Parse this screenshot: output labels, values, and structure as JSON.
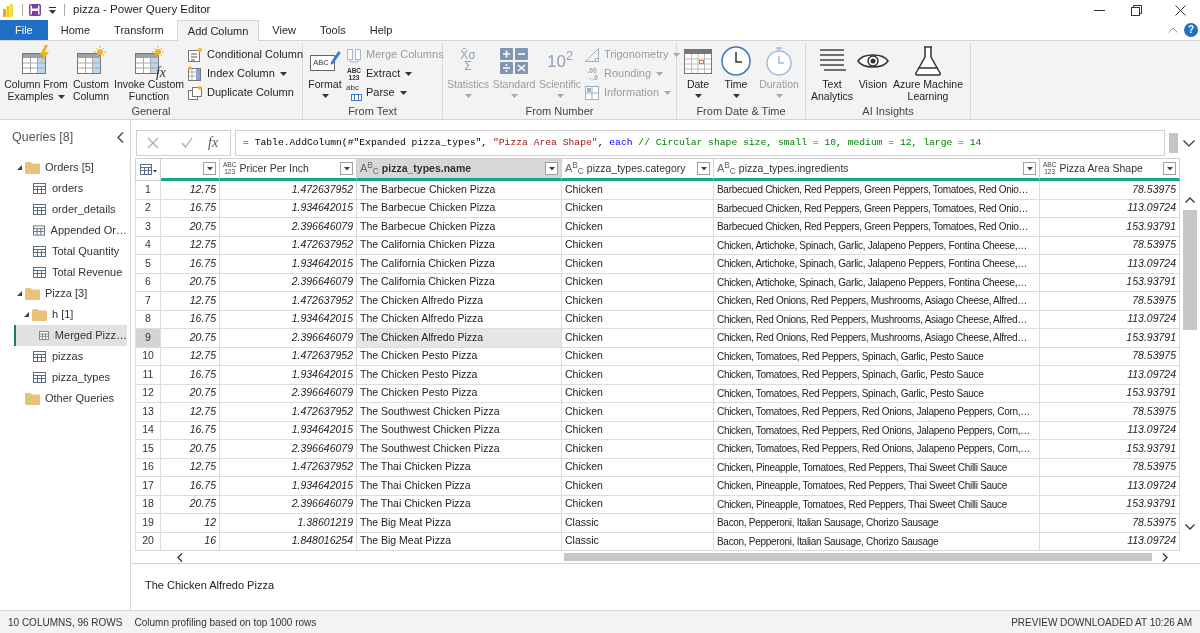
{
  "window": {
    "title": "pizza - Power Query Editor"
  },
  "tabs": [
    {
      "label": "File",
      "kind": "file",
      "selected": false
    },
    {
      "label": "Home",
      "kind": "tab",
      "selected": false
    },
    {
      "label": "Transform",
      "kind": "tab",
      "selected": false
    },
    {
      "label": "Add Column",
      "kind": "tab",
      "selected": true
    },
    {
      "label": "View",
      "kind": "tab",
      "selected": false
    },
    {
      "label": "Tools",
      "kind": "tab",
      "selected": false
    },
    {
      "label": "Help",
      "kind": "tab",
      "selected": false
    }
  ],
  "help": {
    "label": "?"
  },
  "ribbon": {
    "groups": [
      {
        "label": "General",
        "buttons": [
          {
            "kind": "large",
            "label": "Column From Examples",
            "dropdown": true,
            "disabled": false
          },
          {
            "kind": "large",
            "label": "Custom Column",
            "dropdown": false,
            "disabled": false
          },
          {
            "kind": "large",
            "label": "Invoke Custom Function",
            "dropdown": false,
            "disabled": false,
            "glyph": [
              "fx"
            ]
          },
          {
            "kind": "small",
            "label": "Conditional Column",
            "dropdown": false,
            "disabled": false
          },
          {
            "kind": "small",
            "label": "Index Column",
            "dropdown": true,
            "disabled": false
          },
          {
            "kind": "small",
            "label": "Duplicate Column",
            "dropdown": false,
            "disabled": false
          }
        ]
      },
      {
        "label": "From Text",
        "buttons": [
          {
            "kind": "large",
            "label": "Format",
            "dropdown": true,
            "disabled": false,
            "glyph": [
              "ABC"
            ]
          },
          {
            "kind": "small",
            "label": "Merge Columns",
            "dropdown": false,
            "disabled": true
          },
          {
            "kind": "small",
            "label": "Extract",
            "dropdown": true,
            "disabled": false,
            "glyph": [
              "ABC",
              "123"
            ]
          },
          {
            "kind": "small",
            "label": "Parse",
            "dropdown": true,
            "disabled": false,
            "glyph": [
              "abc"
            ]
          }
        ]
      },
      {
        "label": "From Number",
        "buttons": [
          {
            "kind": "large",
            "label": "Statistics",
            "dropdown": true,
            "disabled": true,
            "glyph": [
              "X̄σ",
              "Σ"
            ]
          },
          {
            "kind": "large",
            "label": "Standard",
            "dropdown": true,
            "disabled": true
          },
          {
            "kind": "large",
            "label": "Scientific",
            "dropdown": true,
            "disabled": true,
            "glyph": [
              "10$^{2}$"
            ]
          },
          {
            "kind": "small",
            "label": "Trigonometry",
            "dropdown": true,
            "disabled": true
          },
          {
            "kind": "small",
            "label": "Rounding",
            "dropdown": true,
            "disabled": true,
            "glyph": [
              ".00",
              "→.0"
            ]
          },
          {
            "kind": "small",
            "label": "Information",
            "dropdown": true,
            "disabled": true
          }
        ]
      },
      {
        "label": "From Date & Time",
        "buttons": [
          {
            "kind": "large",
            "label": "Date",
            "dropdown": true,
            "disabled": false
          },
          {
            "kind": "large",
            "label": "Time",
            "dropdown": true,
            "disabled": false
          },
          {
            "kind": "large",
            "label": "Duration",
            "dropdown": true,
            "disabled": true
          }
        ]
      },
      {
        "label": "AI Insights",
        "buttons": [
          {
            "kind": "large",
            "label": "Text Analytics",
            "dropdown": false,
            "disabled": false
          },
          {
            "kind": "large",
            "label": "Vision",
            "dropdown": false,
            "disabled": false
          },
          {
            "kind": "large",
            "label": "Azure Machine Learning",
            "dropdown": false,
            "disabled": false
          }
        ]
      }
    ]
  },
  "queries": {
    "title": "Queries [8]",
    "tree": [
      {
        "label": "Orders [5]",
        "kind": "folder",
        "expanded": true,
        "selected": false,
        "children": [
          {
            "label": "orders",
            "kind": "query",
            "selected": false
          },
          {
            "label": "order_details",
            "kind": "query",
            "selected": false
          },
          {
            "label": "Appended Or…",
            "kind": "query",
            "selected": false
          },
          {
            "label": "Total Quantity",
            "kind": "query",
            "selected": false
          },
          {
            "label": "Total Revenue",
            "kind": "query",
            "selected": false
          }
        ]
      },
      {
        "label": "Pizza [3]",
        "kind": "folder",
        "expanded": true,
        "selected": false,
        "children": [
          {
            "label": "h [1]",
            "kind": "folder",
            "expanded": true,
            "selected": false,
            "children": [
              {
                "label": "Merged Pizz…",
                "kind": "query",
                "selected": true
              }
            ]
          },
          {
            "label": "pizzas",
            "kind": "query",
            "selected": false
          },
          {
            "label": "pizza_types",
            "kind": "query",
            "selected": false
          }
        ]
      },
      {
        "label": "Other Queries",
        "kind": "folder",
        "selected": false
      }
    ]
  },
  "formula_bar": {
    "fx_label": "fx",
    "segments": [
      {
        "kind": "plain",
        "text": "= Table.AddColumn(#\"Expanded pizza_types\", "
      },
      {
        "kind": "string",
        "text": "\"Pizza Area Shape\""
      },
      {
        "kind": "plain",
        "text": ", "
      },
      {
        "kind": "keyword",
        "text": "each"
      },
      {
        "kind": "comment",
        "text": " // Circular shape size, small = 10, medium = 12, large = 14"
      }
    ]
  },
  "table": {
    "columns": [
      {
        "kind": "number",
        "selected": false
      },
      {
        "kind": "number",
        "label": "Pricer Per Inch",
        "type_glyph": [
          "ABC",
          "123"
        ],
        "selected": false
      },
      {
        "kind": "text",
        "label": "pizza_types.name",
        "type_glyph": [
          "A$^{B}$$_{C}$"
        ],
        "selected": true
      },
      {
        "kind": "text",
        "label": "pizza_types.category",
        "type_glyph": [
          "A$^{B}$$_{C}$"
        ],
        "selected": false
      },
      {
        "kind": "text",
        "label": "pizza_types.ingredients",
        "type_glyph": [
          "A$^{B}$$_{C}$"
        ],
        "selected": false
      },
      {
        "kind": "number",
        "label": "Pizza Area Shape",
        "type_glyph": [
          "ABC",
          "123"
        ],
        "selected": false
      }
    ],
    "rows": [
      {
        "number": "1",
        "selected": false,
        "cells": [
          "12.75",
          "1.472637952",
          "The Barbecue Chicken Pizza",
          "Chicken",
          "Barbecued Chicken, Red Peppers, Green Peppers, Tomatoes, Red Onio…",
          "78.53975"
        ]
      },
      {
        "number": "2",
        "selected": false,
        "cells": [
          "16.75",
          "1.934642015",
          "The Barbecue Chicken Pizza",
          "Chicken",
          "Barbecued Chicken, Red Peppers, Green Peppers, Tomatoes, Red Onio…",
          "113.09724"
        ]
      },
      {
        "number": "3",
        "selected": false,
        "cells": [
          "20.75",
          "2.396646079",
          "The Barbecue Chicken Pizza",
          "Chicken",
          "Barbecued Chicken, Red Peppers, Green Peppers, Tomatoes, Red Onio…",
          "153.93791"
        ]
      },
      {
        "number": "4",
        "selected": false,
        "cells": [
          "12.75",
          "1.472637952",
          "The California Chicken Pizza",
          "Chicken",
          "Chicken, Artichoke, Spinach, Garlic, Jalapeno Peppers, Fontina Cheese,…",
          "78.53975"
        ]
      },
      {
        "number": "5",
        "selected": false,
        "cells": [
          "16.75",
          "1.934642015",
          "The California Chicken Pizza",
          "Chicken",
          "Chicken, Artichoke, Spinach, Garlic, Jalapeno Peppers, Fontina Cheese,…",
          "113.09724"
        ]
      },
      {
        "number": "6",
        "selected": false,
        "cells": [
          "20.75",
          "2.396646079",
          "The California Chicken Pizza",
          "Chicken",
          "Chicken, Artichoke, Spinach, Garlic, Jalapeno Peppers, Fontina Cheese,…",
          "153.93791"
        ]
      },
      {
        "number": "7",
        "selected": false,
        "cells": [
          "12.75",
          "1.472637952",
          "The Chicken Alfredo Pizza",
          "Chicken",
          "Chicken, Red Onions, Red Peppers, Mushrooms, Asiago Cheese, Alfred…",
          "78.53975"
        ]
      },
      {
        "number": "8",
        "selected": false,
        "cells": [
          "16.75",
          "1.934642015",
          "The Chicken Alfredo Pizza",
          "Chicken",
          "Chicken, Red Onions, Red Peppers, Mushrooms, Asiago Cheese, Alfred…",
          "113.09724"
        ]
      },
      {
        "number": "9",
        "selected": true,
        "cells": [
          "20.75",
          "2.396646079",
          "The Chicken Alfredo Pizza",
          "Chicken",
          "Chicken, Red Onions, Red Peppers, Mushrooms, Asiago Cheese, Alfred…",
          "153.93791"
        ]
      },
      {
        "number": "10",
        "selected": false,
        "cells": [
          "12.75",
          "1.472637952",
          "The Chicken Pesto Pizza",
          "Chicken",
          "Chicken, Tomatoes, Red Peppers, Spinach, Garlic, Pesto Sauce",
          "78.53975"
        ]
      },
      {
        "number": "11",
        "selected": false,
        "cells": [
          "16.75",
          "1.934642015",
          "The Chicken Pesto Pizza",
          "Chicken",
          "Chicken, Tomatoes, Red Peppers, Spinach, Garlic, Pesto Sauce",
          "113.09724"
        ]
      },
      {
        "number": "12",
        "selected": false,
        "cells": [
          "20.75",
          "2.396646079",
          "The Chicken Pesto Pizza",
          "Chicken",
          "Chicken, Tomatoes, Red Peppers, Spinach, Garlic, Pesto Sauce",
          "153.93791"
        ]
      },
      {
        "number": "13",
        "selected": false,
        "cells": [
          "12.75",
          "1.472637952",
          "The Southwest Chicken Pizza",
          "Chicken",
          "Chicken, Tomatoes, Red Peppers, Red Onions, Jalapeno Peppers, Corn,…",
          "78.53975"
        ]
      },
      {
        "number": "14",
        "selected": false,
        "cells": [
          "16.75",
          "1.934642015",
          "The Southwest Chicken Pizza",
          "Chicken",
          "Chicken, Tomatoes, Red Peppers, Red Onions, Jalapeno Peppers, Corn,…",
          "113.09724"
        ]
      },
      {
        "number": "15",
        "selected": false,
        "cells": [
          "20.75",
          "2.396646079",
          "The Southwest Chicken Pizza",
          "Chicken",
          "Chicken, Tomatoes, Red Peppers, Red Onions, Jalapeno Peppers, Corn,…",
          "153.93791"
        ]
      },
      {
        "number": "16",
        "selected": false,
        "cells": [
          "12.75",
          "1.472637952",
          "The Thai Chicken Pizza",
          "Chicken",
          "Chicken, Pineapple, Tomatoes, Red Peppers, Thai Sweet Chilli Sauce",
          "78.53975"
        ]
      },
      {
        "number": "17",
        "selected": false,
        "cells": [
          "16.75",
          "1.934642015",
          "The Thai Chicken Pizza",
          "Chicken",
          "Chicken, Pineapple, Tomatoes, Red Peppers, Thai Sweet Chilli Sauce",
          "113.09724"
        ]
      },
      {
        "number": "18",
        "selected": false,
        "cells": [
          "20.75",
          "2.396646079",
          "The Thai Chicken Pizza",
          "Chicken",
          "Chicken, Pineapple, Tomatoes, Red Peppers, Thai Sweet Chilli Sauce",
          "153.93791"
        ]
      },
      {
        "number": "19",
        "selected": false,
        "cells": [
          "12",
          "1.38601219",
          "The Big Meat Pizza",
          "Classic",
          "Bacon, Pepperoni, Italian Sausage, Chorizo Sausage",
          "78.53975"
        ]
      },
      {
        "number": "20",
        "selected": false,
        "cells": [
          "16",
          "1.848016254",
          "The Big Meat Pizza",
          "Classic",
          "Bacon, Pepperoni, Italian Sausage, Chorizo Sausage",
          "113.09724"
        ]
      }
    ]
  },
  "preview": {
    "text": "The Chicken Alfredo Pizza"
  },
  "status_bar": {
    "left": [
      "10 COLUMNS, 96 ROWS",
      "Column profiling based on top 1000 rows"
    ],
    "right": "PREVIEW DOWNLOADED AT 10:26 AM"
  }
}
